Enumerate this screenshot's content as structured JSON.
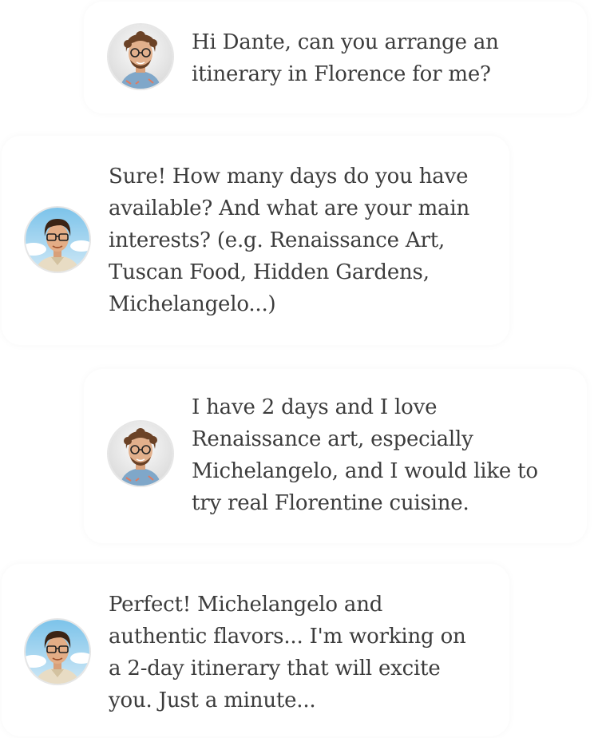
{
  "conversation": {
    "messages": [
      {
        "sender": "user",
        "avatar_icon": "user-avatar-curly-hair-glasses",
        "text": "Hi Dante, can you arrange an itinerary in Florence for me?"
      },
      {
        "sender": "assistant",
        "avatar_icon": "dante-avatar-illustrated-glasses",
        "text": "Sure! How many days do you have available? And what are your main interests? (e.g. Renaissance Art, Tuscan Food, Hidden Gardens, Michelangelo...)"
      },
      {
        "sender": "user",
        "avatar_icon": "user-avatar-curly-hair-glasses",
        "text": "I have 2 days and I love Renaissance art, especially Michelangelo, and I would like to try real Florentine cuisine."
      },
      {
        "sender": "assistant",
        "avatar_icon": "dante-avatar-illustrated-glasses",
        "text": "Perfect! Michelangelo and authentic flavors... I'm working on a 2-day itinerary that will excite you. Just a minute..."
      }
    ]
  },
  "colors": {
    "text": "#3c3c3c",
    "background": "#ffffff",
    "avatar_ring": "#e6e6e6"
  }
}
